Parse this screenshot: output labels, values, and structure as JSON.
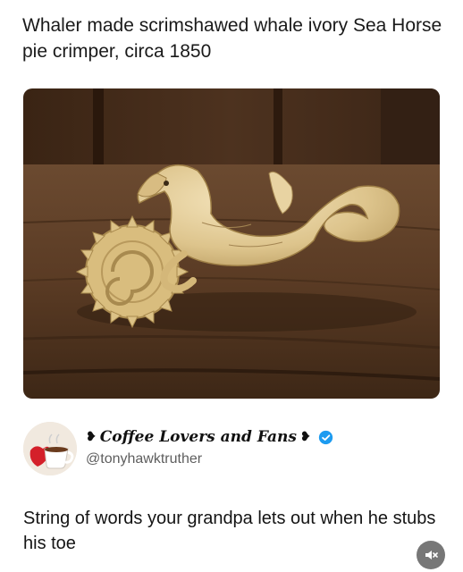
{
  "caption": {
    "text": "Whaler made scrimshawed whale ivory Sea Horse pie crimper, circa 1850"
  },
  "photo": {
    "subject_icon": "seahorse-pie-crimper-photo"
  },
  "post": {
    "account_name": "Coffee Lovers and Fans",
    "name_decoration_left": "❥",
    "name_decoration_right": "❥",
    "handle": "@tonyhawktruther",
    "verified": true,
    "text": "String of words your grandpa lets out when he stubs his toe"
  },
  "controls": {
    "mute_icon": "speaker-muted-icon"
  },
  "colors": {
    "wood": "#5a3a22",
    "ivory": "#e3cc98",
    "verified_blue": "#1d9bf0",
    "mute_bg": "#777777"
  }
}
